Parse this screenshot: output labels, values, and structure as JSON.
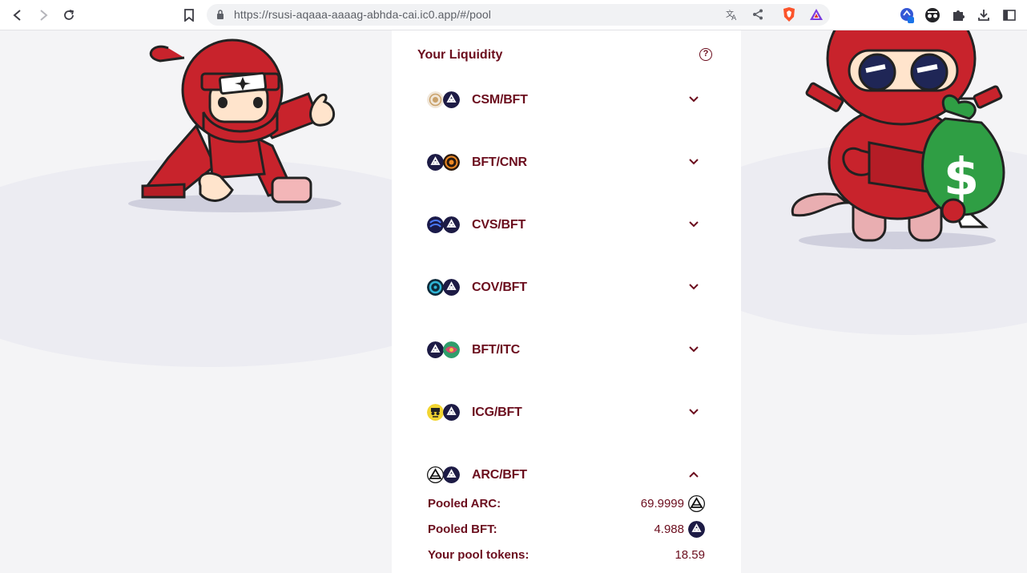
{
  "browser": {
    "url": "https://rsusi-aqaaa-aaaag-abhda-cai.ic0.app/#/pool"
  },
  "liquidity": {
    "title": "Your Liquidity",
    "help_symbol": "?",
    "pairs": [
      {
        "label": "CSM/BFT",
        "icon_a": "csm-token-icon",
        "icon_b": "bft-token-icon",
        "expanded": false
      },
      {
        "label": "BFT/CNR",
        "icon_a": "bft-token-icon",
        "icon_b": "cnr-token-icon",
        "expanded": false
      },
      {
        "label": "CVS/BFT",
        "icon_a": "cvs-token-icon",
        "icon_b": "bft-token-icon",
        "expanded": false
      },
      {
        "label": "COV/BFT",
        "icon_a": "cov-token-icon",
        "icon_b": "bft-token-icon",
        "expanded": false
      },
      {
        "label": "BFT/ITC",
        "icon_a": "bft-token-icon",
        "icon_b": "itc-token-icon",
        "expanded": false
      },
      {
        "label": "ICG/BFT",
        "icon_a": "icg-token-icon",
        "icon_b": "bft-token-icon",
        "expanded": false
      },
      {
        "label": "ARC/BFT",
        "icon_a": "arc-token-icon",
        "icon_b": "bft-token-icon",
        "expanded": true
      }
    ],
    "details": {
      "pooled_a_label": "Pooled ARC:",
      "pooled_a_value": "69.9999",
      "pooled_b_label": "Pooled BFT:",
      "pooled_b_value": "4.988",
      "pool_tokens_label": "Your pool tokens:",
      "pool_tokens_value": "18.59"
    }
  },
  "colors": {
    "accent": "#6b0d1d",
    "panel": "#ffffff",
    "background": "#f4f4f6",
    "mascot_red": "#c8232c",
    "money_bag_green": "#2f9e44"
  }
}
